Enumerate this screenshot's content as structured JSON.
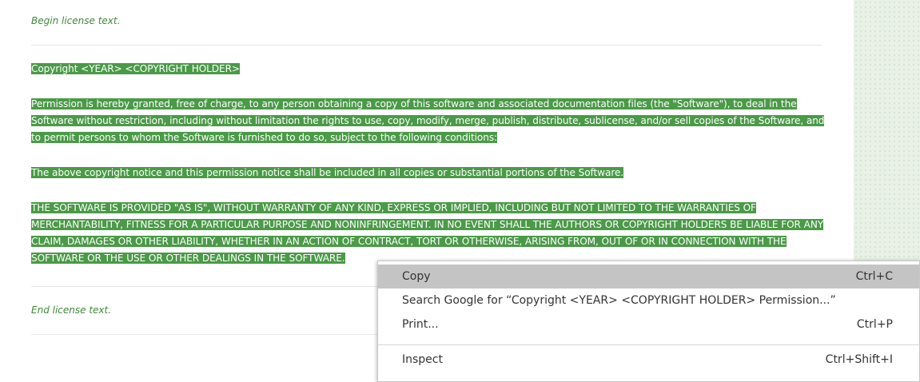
{
  "notes": {
    "begin": "Begin license text.",
    "end": "End license text."
  },
  "license": {
    "copyright_line": "Copyright <YEAR> <COPYRIGHT HOLDER>",
    "permission": "Permission is hereby granted, free of charge, to any person obtaining a copy of this software and associated documentation files (the \"Software\"), to deal in the Software without restriction, including without limitation the rights to use, copy, modify, merge, publish, distribute, sublicense, and/or sell copies of the Software, and to permit persons to whom the Software is furnished to do so, subject to the following conditions:",
    "notice": "The above copyright notice and this permission notice shall be included in all copies or substantial portions of the Software.",
    "warranty": "THE SOFTWARE IS PROVIDED \"AS IS\", WITHOUT WARRANTY OF ANY KIND, EXPRESS OR IMPLIED, INCLUDING BUT NOT LIMITED TO THE WARRANTIES OF MERCHANTABILITY, FITNESS FOR A PARTICULAR PURPOSE AND NONINFRINGEMENT. IN NO EVENT SHALL THE AUTHORS OR COPYRIGHT HOLDERS BE LIABLE FOR ANY CLAIM, DAMAGES OR OTHER LIABILITY, WHETHER IN AN ACTION OF CONTRACT, TORT OR OTHERWISE, ARISING FROM, OUT OF OR IN CONNECTION WITH THE SOFTWARE OR THE USE OR OTHER DEALINGS IN THE SOFTWARE."
  },
  "context_menu": {
    "items": [
      {
        "label": "Copy",
        "shortcut": "Ctrl+C"
      },
      {
        "label": "Search Google for “Copyright <YEAR> <COPYRIGHT HOLDER> Permission...”",
        "shortcut": ""
      },
      {
        "label": "Print...",
        "shortcut": "Ctrl+P"
      },
      {
        "label": "Inspect",
        "shortcut": "Ctrl+Shift+I"
      }
    ]
  },
  "colors": {
    "selection": "#4a9a47",
    "italic_note": "#3f8a3a",
    "menu_hover": "#c4c4c4",
    "sidebar": "#e9f1e6"
  }
}
